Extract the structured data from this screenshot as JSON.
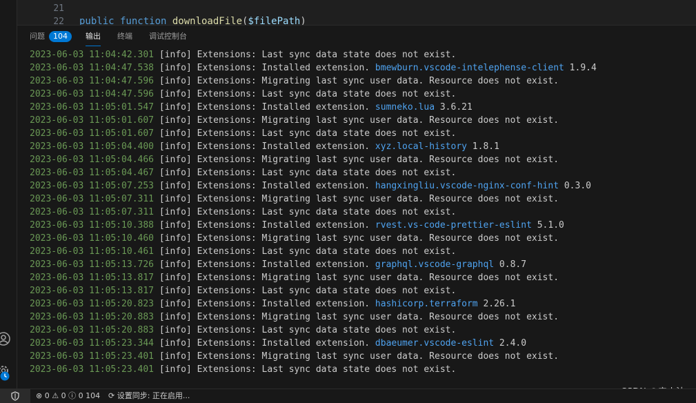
{
  "editor": {
    "lines": [
      {
        "num": "21",
        "code": ""
      },
      {
        "num": "22",
        "kw": "public function ",
        "fn": "downloadFile",
        "punc1": "(",
        "var": "$filePath",
        "punc2": ")"
      }
    ]
  },
  "panel": {
    "tabs": [
      {
        "label": "问题",
        "badge": "104"
      },
      {
        "label": "输出"
      },
      {
        "label": "终端"
      },
      {
        "label": "调试控制台"
      }
    ],
    "active_tab": "输出"
  },
  "log": [
    {
      "ts": "2023-06-03 11:04:42.301",
      "lvl": "[info]",
      "msg": " Extensions: Last sync data state does not exist."
    },
    {
      "ts": "2023-06-03 11:04:47.538",
      "lvl": "[info]",
      "msg": " Extensions: Installed extension. ",
      "ext": "bmewburn.vscode-intelephense-client",
      "ver": " 1.9.4"
    },
    {
      "ts": "2023-06-03 11:04:47.596",
      "lvl": "[info]",
      "msg": " Extensions: Migrating last sync user data. Resource does not exist."
    },
    {
      "ts": "2023-06-03 11:04:47.596",
      "lvl": "[info]",
      "msg": " Extensions: Last sync data state does not exist."
    },
    {
      "ts": "2023-06-03 11:05:01.547",
      "lvl": "[info]",
      "msg": " Extensions: Installed extension. ",
      "ext": "sumneko.lua",
      "ver": " 3.6.21"
    },
    {
      "ts": "2023-06-03 11:05:01.607",
      "lvl": "[info]",
      "msg": " Extensions: Migrating last sync user data. Resource does not exist."
    },
    {
      "ts": "2023-06-03 11:05:01.607",
      "lvl": "[info]",
      "msg": " Extensions: Last sync data state does not exist."
    },
    {
      "ts": "2023-06-03 11:05:04.400",
      "lvl": "[info]",
      "msg": " Extensions: Installed extension. ",
      "ext": "xyz.local-history",
      "ver": " 1.8.1"
    },
    {
      "ts": "2023-06-03 11:05:04.466",
      "lvl": "[info]",
      "msg": " Extensions: Migrating last sync user data. Resource does not exist."
    },
    {
      "ts": "2023-06-03 11:05:04.467",
      "lvl": "[info]",
      "msg": " Extensions: Last sync data state does not exist."
    },
    {
      "ts": "2023-06-03 11:05:07.253",
      "lvl": "[info]",
      "msg": " Extensions: Installed extension. ",
      "ext": "hangxingliu.vscode-nginx-conf-hint",
      "ver": " 0.3.0"
    },
    {
      "ts": "2023-06-03 11:05:07.311",
      "lvl": "[info]",
      "msg": " Extensions: Migrating last sync user data. Resource does not exist."
    },
    {
      "ts": "2023-06-03 11:05:07.311",
      "lvl": "[info]",
      "msg": " Extensions: Last sync data state does not exist."
    },
    {
      "ts": "2023-06-03 11:05:10.388",
      "lvl": "[info]",
      "msg": " Extensions: Installed extension. ",
      "ext": "rvest.vs-code-prettier-eslint",
      "ver": " 5.1.0"
    },
    {
      "ts": "2023-06-03 11:05:10.460",
      "lvl": "[info]",
      "msg": " Extensions: Migrating last sync user data. Resource does not exist."
    },
    {
      "ts": "2023-06-03 11:05:10.461",
      "lvl": "[info]",
      "msg": " Extensions: Last sync data state does not exist."
    },
    {
      "ts": "2023-06-03 11:05:13.726",
      "lvl": "[info]",
      "msg": " Extensions: Installed extension. ",
      "ext": "graphql.vscode-graphql",
      "ver": " 0.8.7"
    },
    {
      "ts": "2023-06-03 11:05:13.817",
      "lvl": "[info]",
      "msg": " Extensions: Migrating last sync user data. Resource does not exist."
    },
    {
      "ts": "2023-06-03 11:05:13.817",
      "lvl": "[info]",
      "msg": " Extensions: Last sync data state does not exist."
    },
    {
      "ts": "2023-06-03 11:05:20.823",
      "lvl": "[info]",
      "msg": " Extensions: Installed extension. ",
      "ext": "hashicorp.terraform",
      "ver": " 2.26.1"
    },
    {
      "ts": "2023-06-03 11:05:20.883",
      "lvl": "[info]",
      "msg": " Extensions: Migrating last sync user data. Resource does not exist."
    },
    {
      "ts": "2023-06-03 11:05:20.883",
      "lvl": "[info]",
      "msg": " Extensions: Last sync data state does not exist."
    },
    {
      "ts": "2023-06-03 11:05:23.344",
      "lvl": "[info]",
      "msg": " Extensions: Installed extension. ",
      "ext": "dbaeumer.vscode-eslint",
      "ver": " 2.4.0"
    },
    {
      "ts": "2023-06-03 11:05:23.401",
      "lvl": "[info]",
      "msg": " Extensions: Migrating last sync user data. Resource does not exist."
    },
    {
      "ts": "2023-06-03 11:05:23.401",
      "lvl": "[info]",
      "msg": " Extensions: Last sync data state does not exist."
    }
  ],
  "statusbar": {
    "errors": "0",
    "warnings": "0",
    "info": "0",
    "info_count": "104",
    "sync": "设置同步: 正在启用..."
  },
  "watermark": "CSDN @宁小法",
  "icons": {
    "account": "account-icon",
    "manage": "gear-icon",
    "remote": "shield-icon"
  },
  "colors": {
    "accent": "#0078d4",
    "timestamp": "#6a9955",
    "extension_link": "#4fa3f0"
  }
}
